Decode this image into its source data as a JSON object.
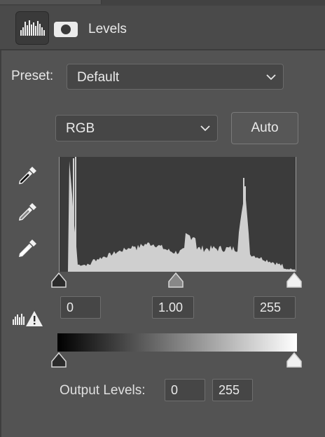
{
  "panel": {
    "title": "Levels",
    "adjustment_icon": "levels-histogram-icon",
    "mask_icon": "layer-mask-icon"
  },
  "preset": {
    "label": "Preset:",
    "value": "Default"
  },
  "channel": {
    "value": "RGB"
  },
  "auto_button": {
    "label": "Auto"
  },
  "eyedroppers": [
    "black-point-eyedropper-icon",
    "gray-point-eyedropper-icon",
    "white-point-eyedropper-icon"
  ],
  "input_levels": {
    "black": "0",
    "gamma": "1.00",
    "white": "255"
  },
  "output_levels": {
    "label": "Output Levels:",
    "black": "0",
    "white": "255"
  },
  "colors": {
    "panel_bg": "#535353",
    "histogram_bg": "#3b3b3b",
    "histogram_fill": "#cfcfcf"
  }
}
